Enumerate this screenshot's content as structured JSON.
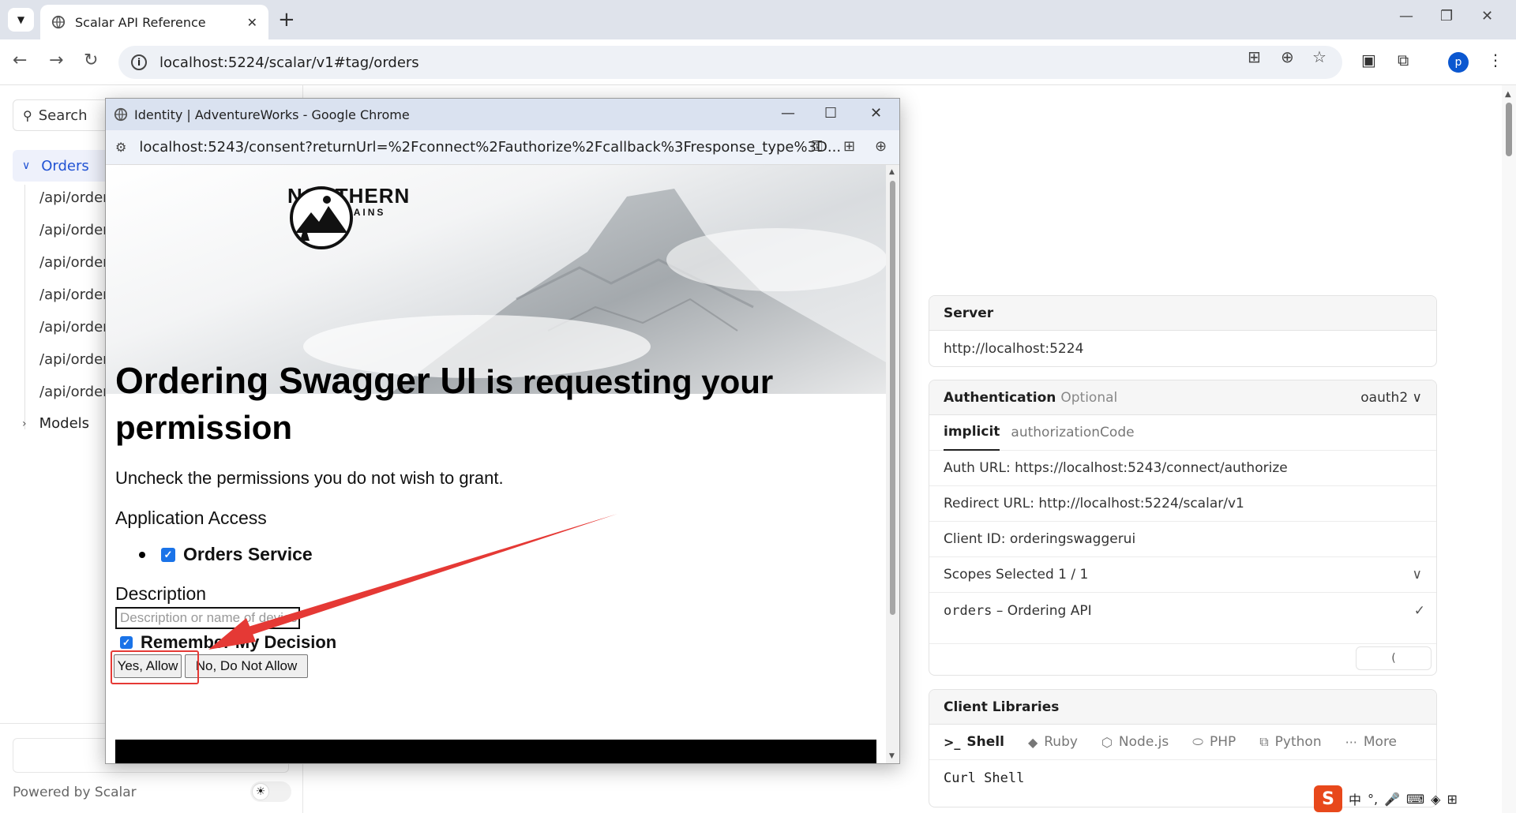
{
  "browser": {
    "tab_title": "Scalar API Reference",
    "new_tab": "+",
    "tab_close": "✕",
    "url": "localhost:5224/scalar/v1#tag/orders",
    "avatar_letter": "p"
  },
  "sidebar": {
    "search_label": "Search",
    "group_label": "Orders",
    "items": [
      "/api/orders",
      "/api/orders",
      "/api/orders",
      "/api/orders",
      "/api/orders",
      "/api/orders",
      "/api/orders"
    ],
    "models_label": "Models",
    "powered_by": "Powered by Scalar"
  },
  "server_card": {
    "title": "Server",
    "url": "http://localhost:5224"
  },
  "auth_card": {
    "title": "Authentication",
    "optional": "Optional",
    "scheme": "oauth2",
    "tabs": [
      "implicit",
      "authorizationCode"
    ],
    "auth_url_label": "Auth URL:",
    "auth_url": "https://localhost:5243/connect/authorize",
    "redirect_label": "Redirect URL:",
    "redirect_url": "http://localhost:5224/scalar/v1",
    "client_id_label": "Client ID:",
    "client_id": "orderingswaggerui",
    "scopes_label": "Scopes Selected 1 / 1",
    "scope_name": "orders",
    "scope_desc": "– Ordering API",
    "authorize_button": "("
  },
  "libraries_card": {
    "title": "Client Libraries",
    "tabs": [
      "Shell",
      "Ruby",
      "Node.js",
      "PHP",
      "Python",
      "More"
    ],
    "active": "Shell",
    "sub_label": "Curl Shell"
  },
  "popup": {
    "window_title": "Identity | AdventureWorks - Google Chrome",
    "url": "localhost:5243/consent?returnUrl=%2Fconnect%2Fauthorize%2Fcallback%3Fresponse_type%3D...",
    "logo_word": "NORTHERN",
    "logo_sub": "MOUNTAINS",
    "heading_app": "Ordering Swagger UI",
    "heading_rest": " is requesting your permission",
    "subtext": "Uncheck the permissions you do not wish to grant.",
    "application_access": "Application Access",
    "permission_item": "Orders Service",
    "description_label": "Description",
    "description_placeholder": "Description or name of device",
    "remember_label": "Remember My Decision",
    "allow_button": "Yes, Allow",
    "deny_button": "No, Do Not Allow"
  },
  "tray": {
    "ime_logo": "S",
    "ime_lang": "中"
  },
  "colors": {
    "accent": "#2153d4",
    "annotation_red": "#e53935",
    "checkbox_blue": "#1a73e8"
  }
}
